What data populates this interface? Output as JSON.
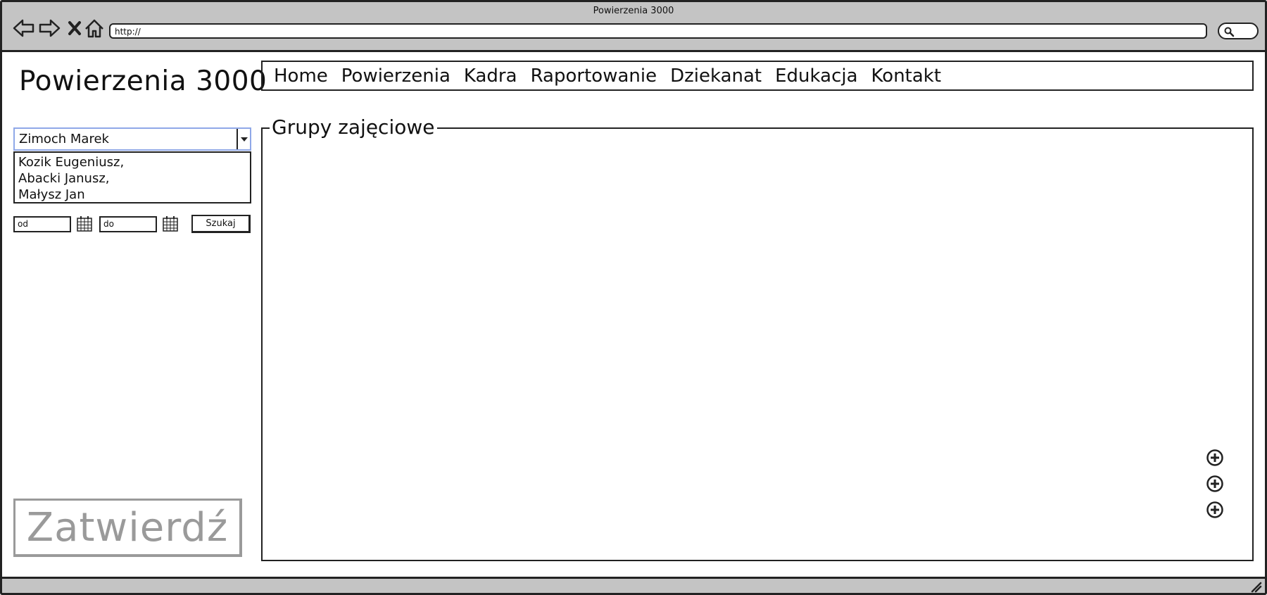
{
  "window": {
    "title": "Powierzenia 3000"
  },
  "browser": {
    "url": "http://",
    "icons": [
      "back-arrow-icon",
      "forward-arrow-icon",
      "close-x-icon",
      "home-icon",
      "search-icon"
    ]
  },
  "header": {
    "app_title": "Powierzenia 3000"
  },
  "menu": {
    "items": [
      {
        "label": "Home"
      },
      {
        "label": "Powierzenia"
      },
      {
        "label": "Kadra"
      },
      {
        "label": "Raportowanie"
      },
      {
        "label": "Dziekanat"
      },
      {
        "label": "Edukacja"
      },
      {
        "label": "Kontakt"
      }
    ]
  },
  "sidebar": {
    "combo": {
      "selected": "Zimoch Marek"
    },
    "list": {
      "items": [
        "Kozik Eugeniusz,",
        "Abacki Janusz,",
        "Małysz Jan"
      ]
    },
    "date_from": {
      "placeholder": "od"
    },
    "date_to": {
      "placeholder": "do"
    },
    "search_label": "Szukaj",
    "confirm_label": "Zatwierdź"
  },
  "main": {
    "group_title": "Grupy zajęciowe",
    "add_buttons": 3
  },
  "colors": {
    "chrome": "#c4c4c4",
    "border": "#222222",
    "combo_focus": "#8fa8e8",
    "disabled_text": "#9a9a9a"
  }
}
